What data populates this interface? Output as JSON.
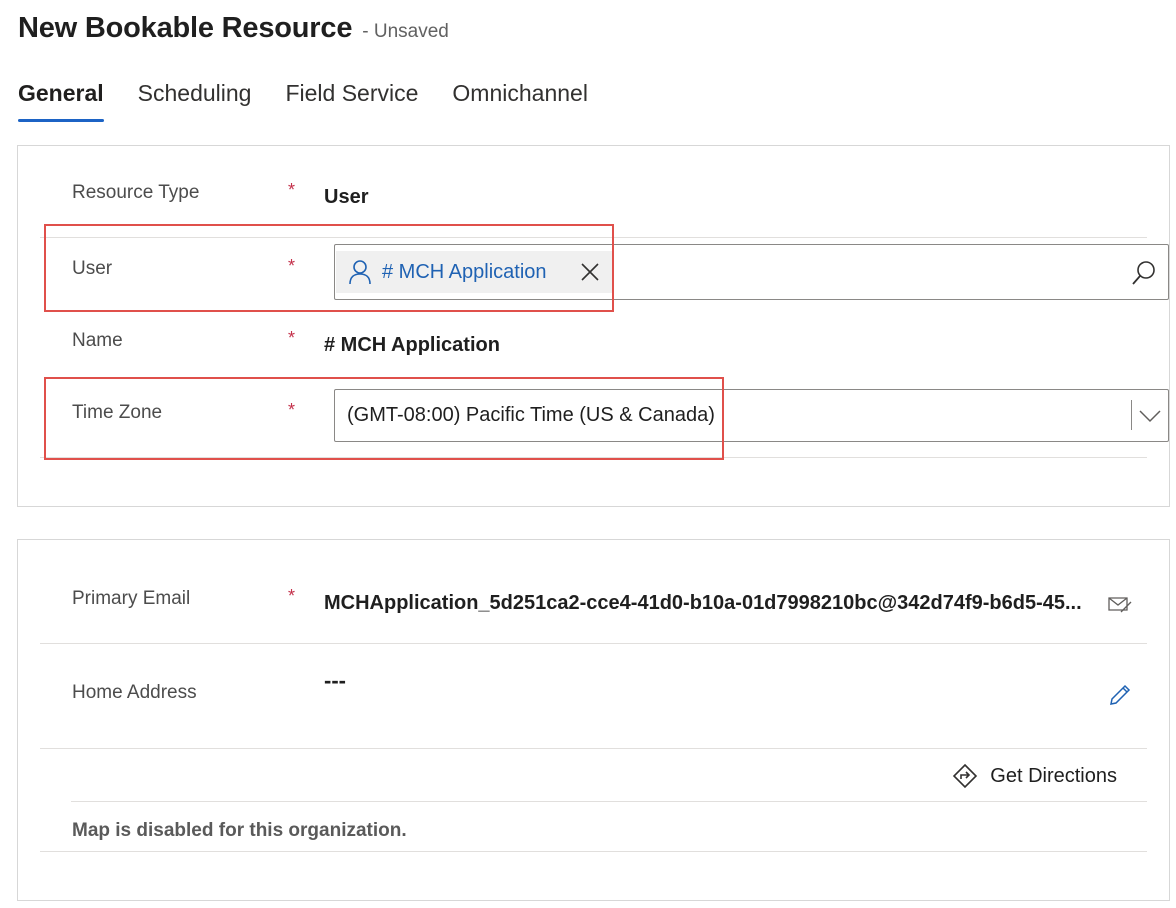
{
  "header": {
    "title": "New Bookable Resource",
    "status": "- Unsaved"
  },
  "tabs": [
    {
      "label": "General",
      "active": true
    },
    {
      "label": "Scheduling",
      "active": false
    },
    {
      "label": "Field Service",
      "active": false
    },
    {
      "label": "Omnichannel",
      "active": false
    }
  ],
  "general": {
    "resource_type": {
      "label": "Resource Type",
      "required": "*",
      "value": "User"
    },
    "user": {
      "label": "User",
      "required": "*",
      "value": "# MCH Application"
    },
    "name": {
      "label": "Name",
      "required": "*",
      "value": "# MCH Application"
    },
    "time_zone": {
      "label": "Time Zone",
      "required": "*",
      "value": "(GMT-08:00) Pacific Time (US & Canada)"
    }
  },
  "contact": {
    "primary_email": {
      "label": "Primary Email",
      "required": "*",
      "value": "MCHApplication_5d251ca2-cce4-41d0-b10a-01d7998210bc@342d74f9-b6d5-45..."
    },
    "home_address": {
      "label": "Home Address",
      "value": "---"
    },
    "get_directions": "Get Directions",
    "map_message": "Map is disabled for this organization."
  },
  "colors": {
    "accent": "#1c63c5",
    "required": "#c4314b",
    "highlight": "#e0504b",
    "lookup_text": "#1f62b3"
  }
}
